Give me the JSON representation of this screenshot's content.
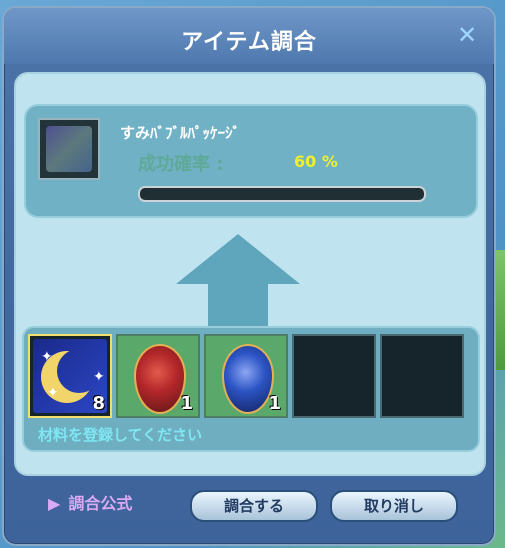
{
  "window": {
    "title": "アイテム調合",
    "close_glyph": "✕"
  },
  "result": {
    "item_name": "すみﾊﾞﾌﾞﾙﾊﾟｯｹｰｼﾞ",
    "rate_label": "成功確率 :",
    "rate_value": "60 %",
    "progress_fraction": 0
  },
  "materials": {
    "slots": [
      {
        "icon": "moon-icon",
        "count": "8",
        "selected": true
      },
      {
        "icon": "red-gem-icon",
        "count": "1",
        "selected": false
      },
      {
        "icon": "blue-gem-icon",
        "count": "1",
        "selected": false
      },
      {
        "icon": "",
        "count": "",
        "selected": false
      },
      {
        "icon": "",
        "count": "",
        "selected": false
      }
    ],
    "hint": "材料を登録してください"
  },
  "footer": {
    "formula_label": "調合公式",
    "craft_button": "調合する",
    "cancel_button": "取り消し"
  },
  "colors": {
    "panel": "#bfe4ef",
    "accent_yellow": "#f0f02a",
    "hint_cyan": "#7fe6f2"
  }
}
